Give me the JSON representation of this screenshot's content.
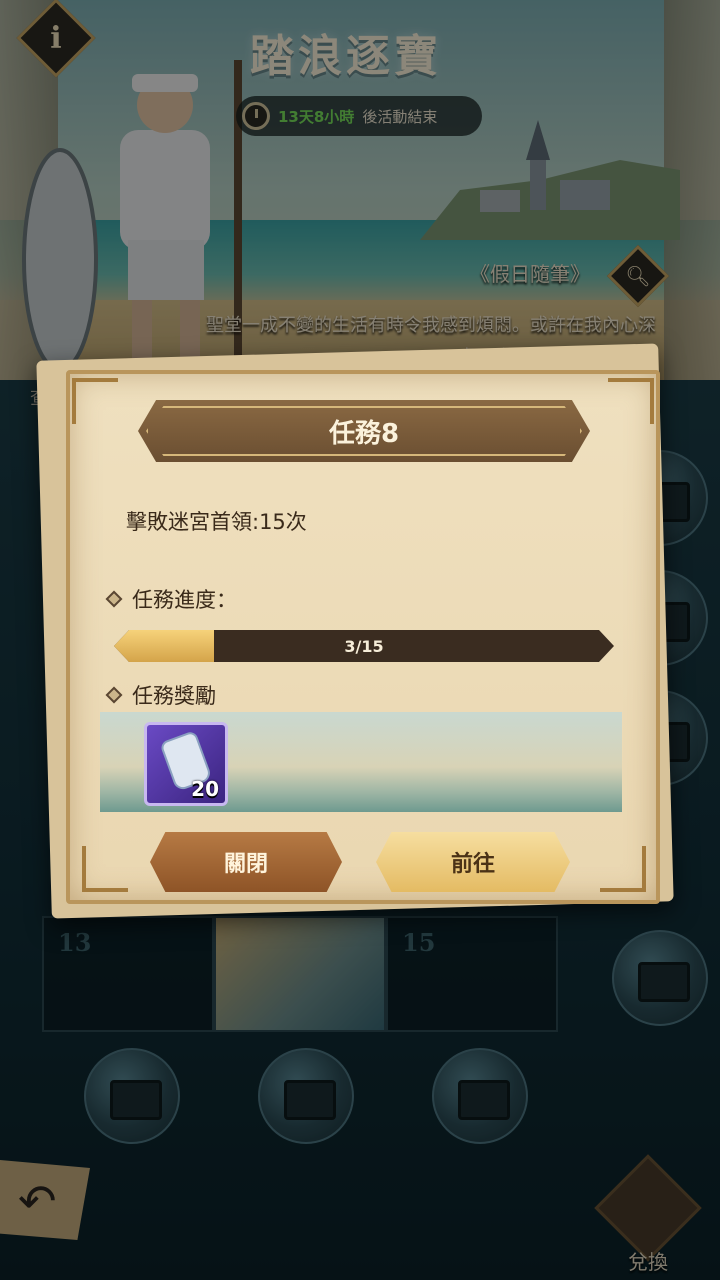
{
  "event": {
    "title": "踏浪逐寶",
    "timer_remaining": "13天8小時",
    "timer_suffix": "後活動結束",
    "diary_label": "《假日隨筆》",
    "quote": "聖堂一成不變的生活有時令我感到煩悶。或許在我內心深處，也是嚮往自由的吧。",
    "view_label": "查"
  },
  "board": {
    "cell_numbers": [
      "13",
      "15"
    ]
  },
  "dialog": {
    "title": "任務8",
    "task_description": "擊敗迷宮首領:15次",
    "progress_label": "任務進度：",
    "progress_text": "3/15",
    "progress_current": 3,
    "progress_total": 15,
    "reward_label": "任務獎勵",
    "reward_item": {
      "icon": "potion-bottle-icon",
      "count": "20"
    },
    "close_button": "關閉",
    "go_button": "前往"
  },
  "footer": {
    "exchange_label": "兌換"
  },
  "colors": {
    "timer_green": "#79e35c",
    "dialog_parchment": "#efe0bf",
    "progress_fill": "#e0b45a",
    "go_button": "#f0cf86",
    "close_button": "#a46838"
  }
}
